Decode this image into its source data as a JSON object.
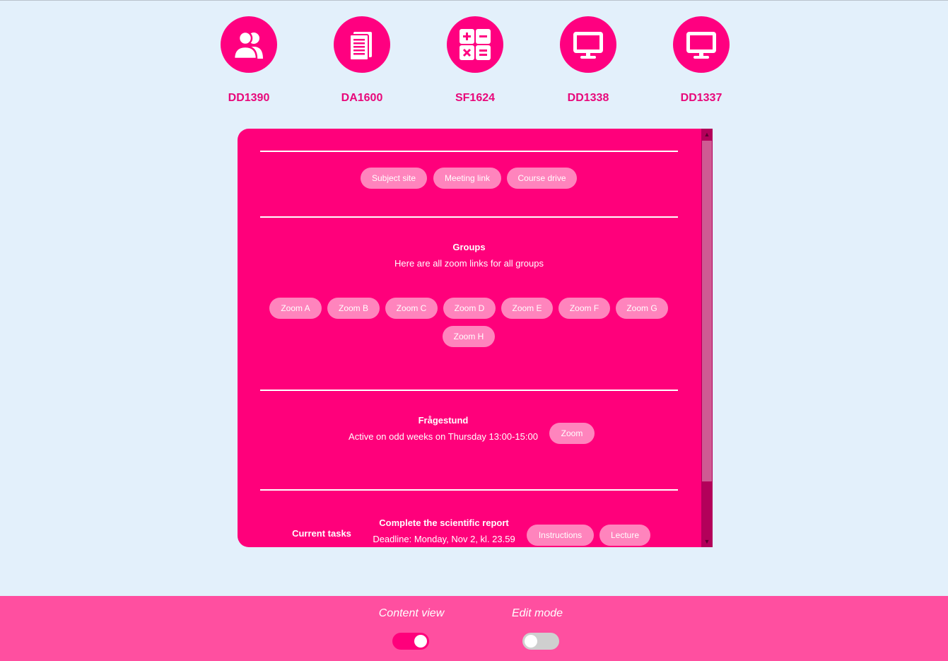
{
  "courses": [
    {
      "code": "DD1390",
      "icon": "users-icon"
    },
    {
      "code": "DA1600",
      "icon": "documents-icon"
    },
    {
      "code": "SF1624",
      "icon": "calculator-icon"
    },
    {
      "code": "DD1338",
      "icon": "monitor-icon"
    },
    {
      "code": "DD1337",
      "icon": "monitor-icon"
    }
  ],
  "links": {
    "subject_site": "Subject site",
    "meeting_link": "Meeting link",
    "course_drive": "Course drive"
  },
  "groups": {
    "title": "Groups",
    "description": "Here are all zoom links for all groups",
    "buttons": [
      "Zoom A",
      "Zoom B",
      "Zoom C",
      "Zoom D",
      "Zoom E",
      "Zoom F",
      "Zoom G",
      "Zoom H"
    ]
  },
  "fragestund": {
    "title": "Frågestund",
    "description": "Active on odd weeks on Thursday 13:00-15:00",
    "button": "Zoom"
  },
  "tasks": {
    "label": "Current tasks",
    "title": "Complete the scientific report",
    "deadline": "Deadline: Monday, Nov 2, kl. 23.59",
    "instructions": "Instructions",
    "lecture": "Lecture"
  },
  "footer": {
    "content_view": "Content view",
    "content_view_on": true,
    "edit_mode": "Edit mode",
    "edit_mode_on": false
  },
  "colors": {
    "accent": "#ff007b",
    "background": "#e3f0fb",
    "footer": "#ff4fa0",
    "pill": "#ff84bd"
  }
}
